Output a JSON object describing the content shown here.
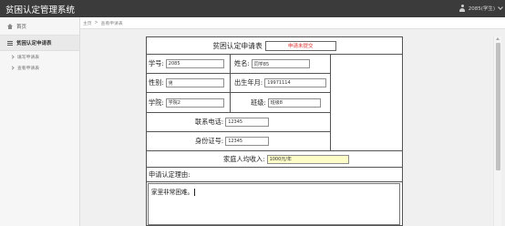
{
  "app": {
    "title": "贫困认定管理系统",
    "user_label": "2085(学生)"
  },
  "sidebar": {
    "home_label": "首页",
    "section_label": "贫困认定申请表",
    "items": [
      {
        "label": "填写申请表"
      },
      {
        "label": "查看申请表"
      }
    ]
  },
  "breadcrumb": {
    "home": "主页",
    "separator": ">",
    "current": "查看申请表"
  },
  "form": {
    "title": "贫困认定申请表",
    "status": "申请未提交",
    "student_id": {
      "label": "学号:",
      "value": "2085"
    },
    "name": {
      "label": "姓名:",
      "value": "同学85"
    },
    "gender": {
      "label": "性别:",
      "value": "男"
    },
    "birth": {
      "label": "出生年月:",
      "value": "19971114"
    },
    "college": {
      "label": "学院:",
      "value": "学院2"
    },
    "class": {
      "label": "班级:",
      "value": "班级8"
    },
    "phone": {
      "label": "联系电话:",
      "value": "12345"
    },
    "id_number": {
      "label": "身份证号:",
      "value": "12345"
    },
    "income": {
      "label": "家庭人均收入:",
      "value": "1000元/年"
    },
    "reason": {
      "label": "申请认定理由:",
      "value": "家里非常困难。"
    }
  },
  "colors": {
    "topbar": "#3b3b3b",
    "status_text": "#e03030",
    "income_highlight": "#fdfdc7"
  }
}
